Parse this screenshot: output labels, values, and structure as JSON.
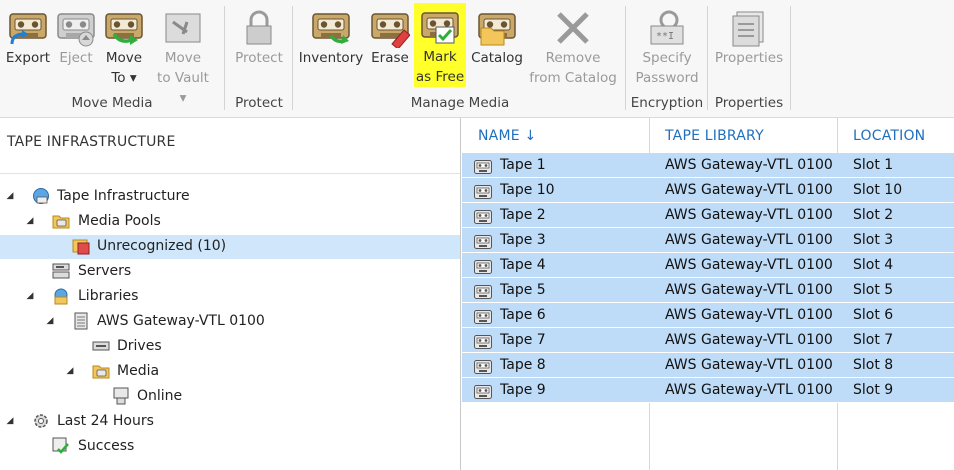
{
  "ribbon": {
    "buttons": [
      {
        "name": "export-button",
        "line1": "Export",
        "line2": "",
        "enabled": true
      },
      {
        "name": "eject-button",
        "line1": "Eject",
        "line2": "",
        "enabled": false
      },
      {
        "name": "move-to-button",
        "line1": "Move",
        "line2": "To ▾",
        "enabled": true
      },
      {
        "name": "move-to-vault-button",
        "line1": "Move",
        "line2": "to Vault ▾",
        "enabled": false
      },
      {
        "name": "protect-button",
        "line1": "Protect",
        "line2": "",
        "enabled": false
      },
      {
        "name": "inventory-button",
        "line1": "Inventory",
        "line2": "",
        "enabled": true
      },
      {
        "name": "erase-button",
        "line1": "Erase",
        "line2": "",
        "enabled": true
      },
      {
        "name": "mark-as-free-button",
        "line1": "Mark",
        "line2": "as Free",
        "enabled": true
      },
      {
        "name": "catalog-button",
        "line1": "Catalog",
        "line2": "",
        "enabled": true
      },
      {
        "name": "remove-from-catalog-button",
        "line1": "Remove",
        "line2": "from Catalog",
        "enabled": false
      },
      {
        "name": "specify-password-button",
        "line1": "Specify",
        "line2": "Password",
        "enabled": false
      },
      {
        "name": "properties-button",
        "line1": "Properties",
        "line2": "",
        "enabled": false
      }
    ],
    "groups": [
      "Move Media",
      "Protect",
      "Manage Media",
      "Encryption",
      "Properties"
    ]
  },
  "tree": {
    "title": "TAPE INFRASTRUCTURE",
    "items": [
      {
        "label": "Tape Infrastructure",
        "arrow": "◢"
      },
      {
        "label": "Media Pools",
        "arrow": "◢"
      },
      {
        "label": "Unrecognized (10)",
        "arrow": ""
      },
      {
        "label": "Servers",
        "arrow": ""
      },
      {
        "label": "Libraries",
        "arrow": "◢"
      },
      {
        "label": "AWS Gateway-VTL 0100",
        "arrow": "◢"
      },
      {
        "label": "Drives",
        "arrow": ""
      },
      {
        "label": "Media",
        "arrow": "◢"
      },
      {
        "label": "Online",
        "arrow": ""
      },
      {
        "label": "Last 24 Hours",
        "arrow": "◢"
      },
      {
        "label": "Success",
        "arrow": ""
      }
    ]
  },
  "table": {
    "columns": [
      "NAME",
      "TAPE LIBRARY",
      "LOCATION"
    ],
    "sort_indicator": "↓",
    "rows": [
      {
        "name": "Tape 1",
        "library": "AWS Gateway-VTL 0100",
        "location": "Slot 1"
      },
      {
        "name": "Tape 10",
        "library": "AWS Gateway-VTL 0100",
        "location": "Slot 10"
      },
      {
        "name": "Tape 2",
        "library": "AWS Gateway-VTL 0100",
        "location": "Slot 2"
      },
      {
        "name": "Tape 3",
        "library": "AWS Gateway-VTL 0100",
        "location": "Slot 3"
      },
      {
        "name": "Tape 4",
        "library": "AWS Gateway-VTL 0100",
        "location": "Slot 4"
      },
      {
        "name": "Tape 5",
        "library": "AWS Gateway-VTL 0100",
        "location": "Slot 5"
      },
      {
        "name": "Tape 6",
        "library": "AWS Gateway-VTL 0100",
        "location": "Slot 6"
      },
      {
        "name": "Tape 7",
        "library": "AWS Gateway-VTL 0100",
        "location": "Slot 7"
      },
      {
        "name": "Tape 8",
        "library": "AWS Gateway-VTL 0100",
        "location": "Slot 8"
      },
      {
        "name": "Tape 9",
        "library": "AWS Gateway-VTL 0100",
        "location": "Slot 9"
      }
    ]
  },
  "colors": {
    "accent": "#1f6fbf",
    "selection": "#bedcf8",
    "highlight": "#ffff2a"
  }
}
